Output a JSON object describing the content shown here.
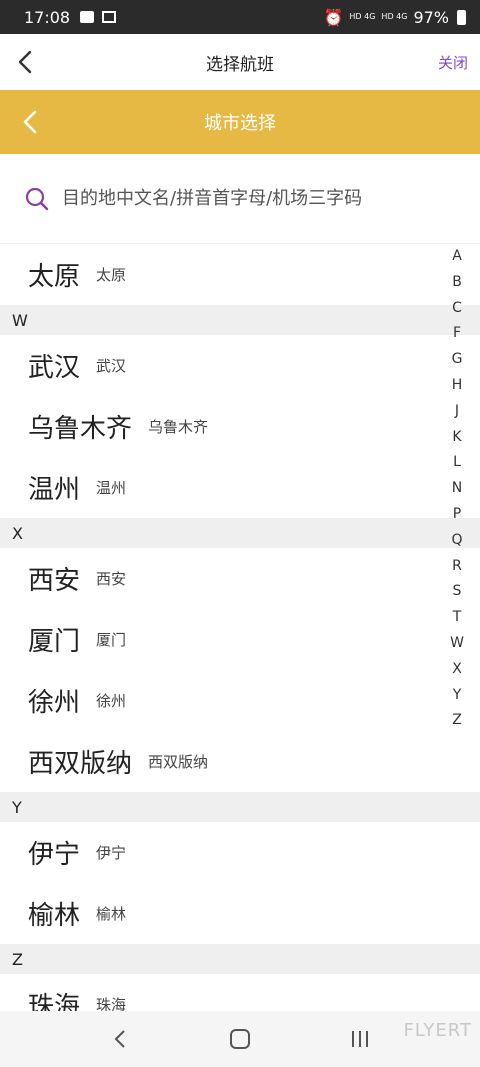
{
  "status_bar": {
    "time": "17:08",
    "network": "HD 4G",
    "network2": "HD 4G",
    "battery": "97%"
  },
  "top_nav": {
    "title": "选择航班",
    "close_label": "关闭"
  },
  "city_bar": {
    "title": "城市选择"
  },
  "search": {
    "placeholder": "目的地中文名/拼音首字母/机场三字码"
  },
  "list": [
    {
      "type": "city",
      "name": "太原",
      "sub": "太原"
    },
    {
      "type": "header",
      "label": "W"
    },
    {
      "type": "city",
      "name": "武汉",
      "sub": "武汉"
    },
    {
      "type": "city",
      "name": "乌鲁木齐",
      "sub": "乌鲁木齐"
    },
    {
      "type": "city",
      "name": "温州",
      "sub": "温州"
    },
    {
      "type": "header",
      "label": "X"
    },
    {
      "type": "city",
      "name": "西安",
      "sub": "西安"
    },
    {
      "type": "city",
      "name": "厦门",
      "sub": "厦门"
    },
    {
      "type": "city",
      "name": "徐州",
      "sub": "徐州"
    },
    {
      "type": "city",
      "name": "西双版纳",
      "sub": "西双版纳"
    },
    {
      "type": "header",
      "label": "Y"
    },
    {
      "type": "city",
      "name": "伊宁",
      "sub": "伊宁"
    },
    {
      "type": "city",
      "name": "榆林",
      "sub": "榆林"
    },
    {
      "type": "header",
      "label": "Z"
    },
    {
      "type": "city",
      "name": "珠海",
      "sub": "珠海"
    }
  ],
  "index_letters": [
    "A",
    "B",
    "C",
    "F",
    "G",
    "H",
    "J",
    "K",
    "L",
    "N",
    "P",
    "Q",
    "R",
    "S",
    "T",
    "W",
    "X",
    "Y",
    "Z"
  ],
  "watermark": "FLYERT",
  "colors": {
    "accent_yellow": "#e5b944",
    "close_purple": "#7c4bc0",
    "search_icon_purple": "#8a3fa0"
  }
}
